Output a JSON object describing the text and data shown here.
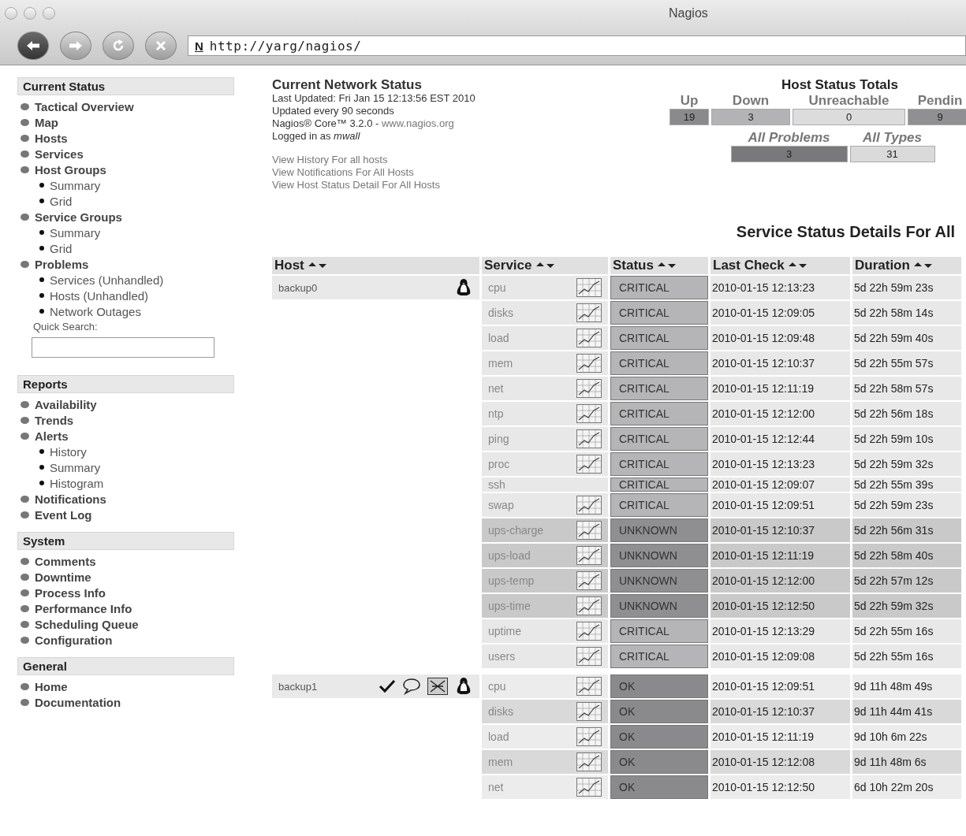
{
  "window": {
    "title": "Nagios",
    "url": "http://yarg/nagios/",
    "favicon": "N"
  },
  "sidebar": [
    {
      "title": "Current Status",
      "items": [
        {
          "label": "Tactical Overview"
        },
        {
          "label": "Map"
        },
        {
          "label": "Hosts"
        },
        {
          "label": "Services"
        },
        {
          "label": "Host Groups",
          "children": [
            {
              "label": "Summary"
            },
            {
              "label": "Grid"
            }
          ]
        },
        {
          "label": "Service Groups",
          "children": [
            {
              "label": "Summary"
            },
            {
              "label": "Grid"
            }
          ]
        },
        {
          "label": "Problems",
          "children": [
            {
              "label": "Services (Unhandled)"
            },
            {
              "label": "Hosts (Unhandled)"
            },
            {
              "label": "Network Outages"
            }
          ]
        }
      ],
      "search_label": "Quick Search:"
    },
    {
      "title": "Reports",
      "items": [
        {
          "label": "Availability"
        },
        {
          "label": "Trends"
        },
        {
          "label": "Alerts",
          "children": [
            {
              "label": "History"
            },
            {
              "label": "Summary"
            },
            {
              "label": "Histogram"
            }
          ]
        },
        {
          "label": "Notifications"
        },
        {
          "label": "Event Log"
        }
      ]
    },
    {
      "title": "System",
      "items": [
        {
          "label": "Comments"
        },
        {
          "label": "Downtime"
        },
        {
          "label": "Process Info"
        },
        {
          "label": "Performance Info"
        },
        {
          "label": "Scheduling Queue"
        },
        {
          "label": "Configuration"
        }
      ]
    },
    {
      "title": "General",
      "items": [
        {
          "label": "Home"
        },
        {
          "label": "Documentation"
        }
      ]
    }
  ],
  "status": {
    "title": "Current Network Status",
    "last_updated": "Last Updated: Fri Jan 15 12:13:56 EST 2010",
    "interval": "Updated every 90 seconds",
    "version": "Nagios® Core™ 3.2.0 - ",
    "version_link": "www.nagios.org",
    "logged_in": "Logged in as ",
    "user": "mwall",
    "links": [
      "View History For all hosts",
      "View Notifications For All Hosts",
      "View Host Status Detail For All Hosts"
    ]
  },
  "host_totals": {
    "title": "Host Status Totals",
    "cells": [
      {
        "label": "Up",
        "value": "19",
        "color": "#8a8a8c"
      },
      {
        "label": "Down",
        "value": "3",
        "color": "#b3b3b5"
      },
      {
        "label": "Unreachable",
        "value": "0",
        "color": "#dcdcdc"
      },
      {
        "label": "Pendin",
        "value": "9",
        "color": "#909092"
      }
    ],
    "summary": [
      {
        "label": "All Problems",
        "value": "3",
        "color": "#79797b"
      },
      {
        "label": "All Types",
        "value": "31",
        "color": "#dadada"
      }
    ]
  },
  "details_title": "Service Status Details For All",
  "columns": [
    "Host",
    "Service",
    "Status",
    "Last Check",
    "Duration"
  ],
  "hosts": [
    {
      "name": "backup0",
      "acknowledged": false,
      "comments": false,
      "notifications_disabled": false,
      "services": [
        {
          "name": "cpu",
          "graph": true,
          "status": "CRITICAL",
          "kind": "critical",
          "last_check": "2010-01-15 12:13:23",
          "duration": "5d 22h 59m 23s"
        },
        {
          "name": "disks",
          "graph": true,
          "status": "CRITICAL",
          "kind": "critical",
          "last_check": "2010-01-15 12:09:05",
          "duration": "5d 22h 58m 14s"
        },
        {
          "name": "load",
          "graph": true,
          "status": "CRITICAL",
          "kind": "critical",
          "last_check": "2010-01-15 12:09:48",
          "duration": "5d 22h 59m 40s"
        },
        {
          "name": "mem",
          "graph": true,
          "status": "CRITICAL",
          "kind": "critical",
          "last_check": "2010-01-15 12:10:37",
          "duration": "5d 22h 55m 57s"
        },
        {
          "name": "net",
          "graph": true,
          "status": "CRITICAL",
          "kind": "critical",
          "last_check": "2010-01-15 12:11:19",
          "duration": "5d 22h 58m 57s"
        },
        {
          "name": "ntp",
          "graph": true,
          "status": "CRITICAL",
          "kind": "critical",
          "last_check": "2010-01-15 12:12:00",
          "duration": "5d 22h 56m 18s"
        },
        {
          "name": "ping",
          "graph": true,
          "status": "CRITICAL",
          "kind": "critical",
          "last_check": "2010-01-15 12:12:44",
          "duration": "5d 22h 59m 10s"
        },
        {
          "name": "proc",
          "graph": true,
          "status": "CRITICAL",
          "kind": "critical",
          "last_check": "2010-01-15 12:13:23",
          "duration": "5d 22h 59m 32s"
        },
        {
          "name": "ssh",
          "graph": false,
          "status": "CRITICAL",
          "kind": "critical",
          "last_check": "2010-01-15 12:09:07",
          "duration": "5d 22h 55m 39s"
        },
        {
          "name": "swap",
          "graph": true,
          "status": "CRITICAL",
          "kind": "critical",
          "last_check": "2010-01-15 12:09:51",
          "duration": "5d 22h 59m 23s"
        },
        {
          "name": "ups-charge",
          "graph": true,
          "status": "UNKNOWN",
          "kind": "unknown",
          "last_check": "2010-01-15 12:10:37",
          "duration": "5d 22h 56m 31s"
        },
        {
          "name": "ups-load",
          "graph": true,
          "status": "UNKNOWN",
          "kind": "unknown",
          "last_check": "2010-01-15 12:11:19",
          "duration": "5d 22h 58m 40s"
        },
        {
          "name": "ups-temp",
          "graph": true,
          "status": "UNKNOWN",
          "kind": "unknown",
          "last_check": "2010-01-15 12:12:00",
          "duration": "5d 22h 57m 12s"
        },
        {
          "name": "ups-time",
          "graph": true,
          "status": "UNKNOWN",
          "kind": "unknown",
          "last_check": "2010-01-15 12:12:50",
          "duration": "5d 22h 59m 32s"
        },
        {
          "name": "uptime",
          "graph": true,
          "status": "CRITICAL",
          "kind": "critical",
          "last_check": "2010-01-15 12:13:29",
          "duration": "5d 22h 55m 16s"
        },
        {
          "name": "users",
          "graph": true,
          "status": "CRITICAL",
          "kind": "critical",
          "last_check": "2010-01-15 12:09:08",
          "duration": "5d 22h 55m 16s"
        }
      ]
    },
    {
      "name": "backup1",
      "acknowledged": true,
      "comments": true,
      "notifications_disabled": true,
      "services": [
        {
          "name": "cpu",
          "graph": true,
          "status": "OK",
          "kind": "ok",
          "last_check": "2010-01-15 12:09:51",
          "duration": "9d 11h 48m 49s"
        },
        {
          "name": "disks",
          "graph": true,
          "status": "OK",
          "kind": "ok",
          "last_check": "2010-01-15 12:10:37",
          "duration": "9d 11h 44m 41s"
        },
        {
          "name": "load",
          "graph": true,
          "status": "OK",
          "kind": "ok",
          "last_check": "2010-01-15 12:11:19",
          "duration": "9d 10h 6m 22s"
        },
        {
          "name": "mem",
          "graph": true,
          "status": "OK",
          "kind": "ok",
          "last_check": "2010-01-15 12:12:08",
          "duration": "9d 11h 48m 6s"
        },
        {
          "name": "net",
          "graph": true,
          "status": "OK",
          "kind": "ok",
          "last_check": "2010-01-15 12:12:50",
          "duration": "6d 10h 22m 20s"
        }
      ]
    }
  ]
}
